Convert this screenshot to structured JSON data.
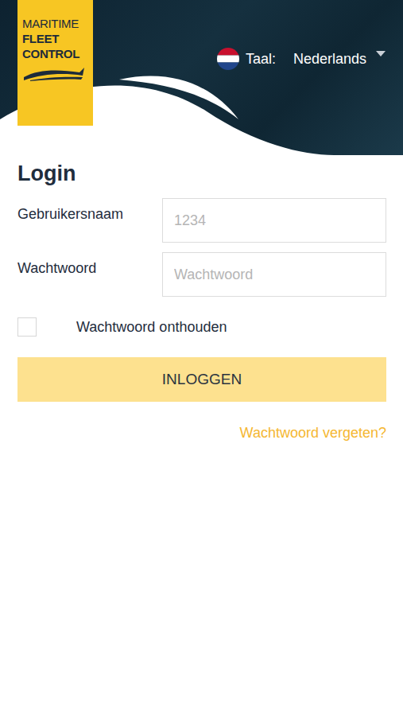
{
  "header": {
    "logo": [
      "MARITIME",
      "FLEET",
      "CONTROL"
    ],
    "language": {
      "label": "Taal:",
      "value": "Nederlands"
    }
  },
  "login": {
    "title": "Login",
    "fields": [
      {
        "label": "Gebruikersnaam",
        "placeholder": "1234"
      },
      {
        "label": "Wachtwoord",
        "placeholder": "Wachtwoord"
      }
    ],
    "remember": {
      "label": "Wachtwoord onthouden",
      "checked": false
    },
    "button": "INLOGGEN",
    "forgot": "Wachtwoord vergeten?"
  }
}
